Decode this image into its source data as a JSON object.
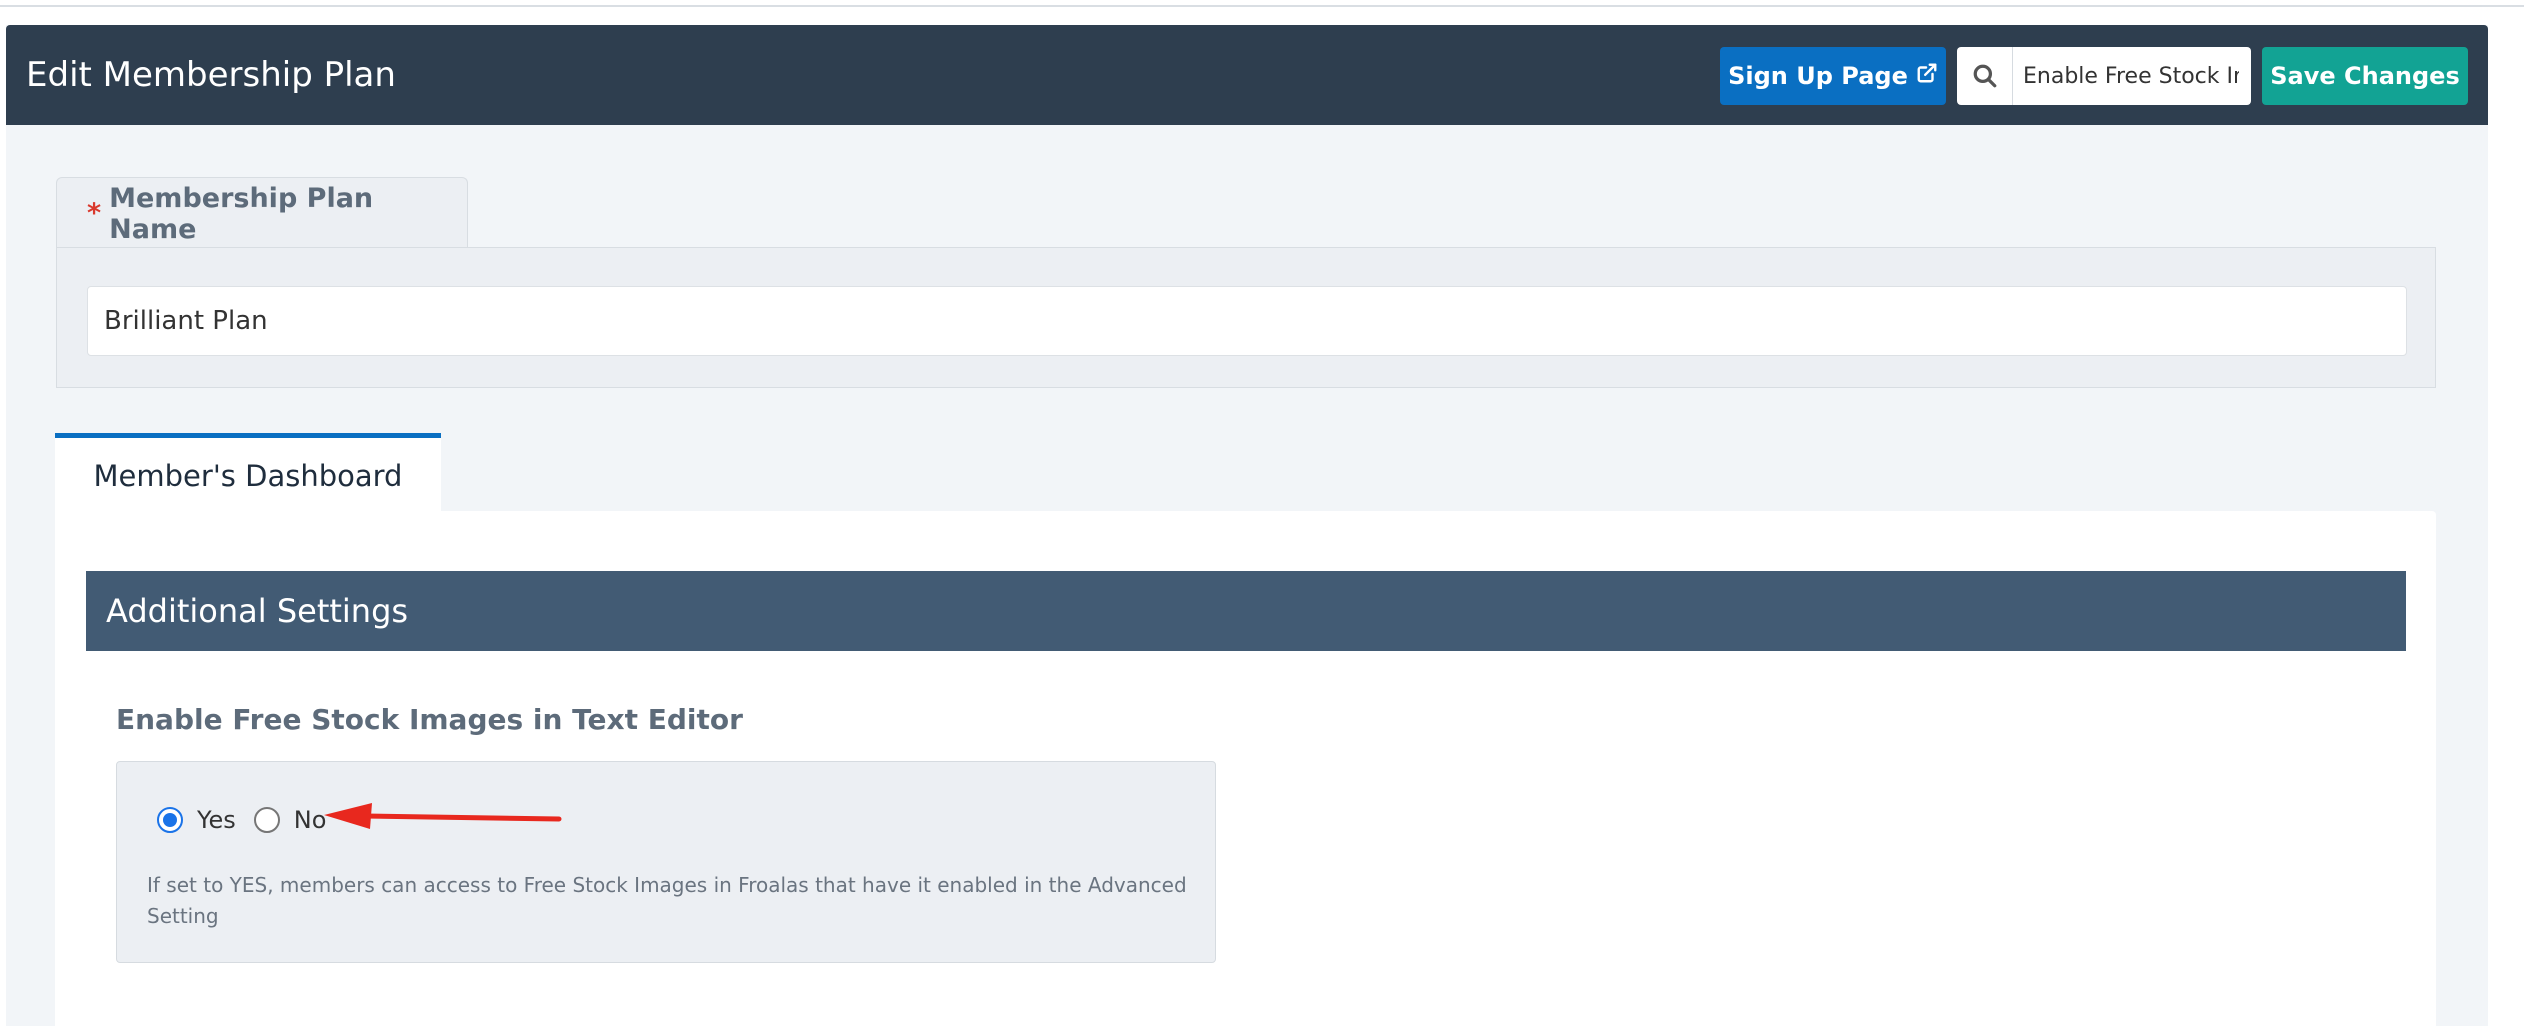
{
  "header": {
    "title": "Edit Membership Plan",
    "signup_label": "Sign Up Page",
    "search_value": "Enable Free Stock Im",
    "save_label": "Save Changes"
  },
  "plan_name": {
    "label": "Membership Plan Name",
    "required_mark": "*",
    "value": "Brilliant Plan"
  },
  "tabs": [
    {
      "label": "Member's Dashboard",
      "active": true
    }
  ],
  "section": {
    "title": "Additional Settings",
    "option_label": "Enable Free Stock Images in Text Editor",
    "options": [
      {
        "label": "Yes",
        "checked": true
      },
      {
        "label": "No",
        "checked": false
      }
    ],
    "help_text": "If set to YES, members can access to Free Stock Images in Froalas that have it enabled in the Advanced Setting"
  },
  "colors": {
    "header_bg": "#2e3e4f",
    "signup_button": "#0a6fc2",
    "save_button": "#12a394",
    "section_bar": "#425b74",
    "annotation_arrow": "#e8281e"
  },
  "icons": {
    "signup": "external-link-icon",
    "search": "search-icon"
  }
}
